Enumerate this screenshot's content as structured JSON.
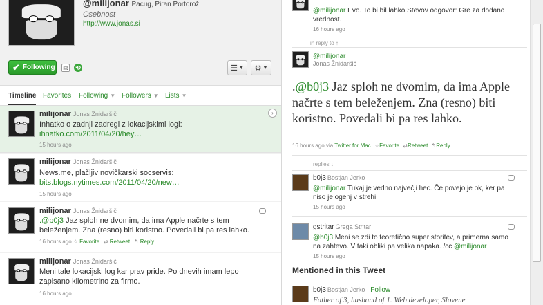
{
  "profile": {
    "username": "@milijonar",
    "location": "Pacug, Piran Portorož",
    "bio": "Osebnost",
    "url": "http://www.jonas.si",
    "following_label": "Following"
  },
  "tabs": [
    {
      "label": "Timeline"
    },
    {
      "label": "Favorites"
    },
    {
      "label": "Following"
    },
    {
      "label": "Followers"
    },
    {
      "label": "Lists"
    }
  ],
  "timeline": [
    {
      "user": "milijonar",
      "fullname": "Jonas Žnidaršič",
      "text_plain": "Inhatko o zadnji zadregi z lokacijskimi logi: ",
      "text_link": "ihnatko.com/2011/04/20/hey…",
      "time": "15 hours ago"
    },
    {
      "user": "milijonar",
      "fullname": "Jonas Žnidaršič",
      "text_plain": "News.me, plačljiv novičkarski socservis: ",
      "text_link": "bits.blogs.nytimes.com/2011/04/20/new…",
      "time": "15 hours ago"
    },
    {
      "user": "milijonar",
      "fullname": "Jonas Žnidaršič",
      "text_mention": ".@b0j3",
      "text_plain": " Jaz sploh ne dvomim, da ima Apple načrte s tem beleženjem. Zna (resno) biti koristno. Povedali bi pa res lahko.",
      "time": "16 hours ago",
      "favorite_label": "Favorite",
      "retweet_label": "Retweet",
      "reply_label": "Reply"
    },
    {
      "user": "milijonar",
      "fullname": "Jonas Žnidaršič",
      "text_plain": "Meni tale lokacijski log kar prav pride. Po dnevih imam lepo zapisano kilometrino za firmo.",
      "time": "16 hours ago"
    }
  ],
  "detail": {
    "top_tweet": {
      "mention": "@milijonar",
      "text": " Evo. To bi bil lahko Stevov odgovor: Gre za dodano vrednost.",
      "time": "16 hours ago"
    },
    "in_reply_to_label": "in reply to ↑",
    "main": {
      "user": "@milijonar",
      "fullname": "Jonas Žnidaršič",
      "text_prefix": ".",
      "mention": "@b0j3",
      "text": " Jaz sploh ne dvomim, da ima Apple načrte s tem beleženjem. Zna (resno) biti koristno. Povedali bi pa res lahko.",
      "time": "16 hours ago",
      "via_label": "via",
      "source": "Twitter for Mac",
      "favorite_label": "Favorite",
      "retweet_label": "Retweet",
      "reply_label": "Reply"
    },
    "replies_label": "replies ↓",
    "replies": [
      {
        "user": "b0j3",
        "fullname": "Bostjan Jerko",
        "mention": "@milijonar",
        "text": " Tukaj je vedno največji hec. Če povejo je ok, ker pa niso je ogenj v strehi.",
        "time": "15 hours ago"
      },
      {
        "user": "gstritar",
        "fullname": "Grega Stritar",
        "mention": "@b0j3",
        "text": " Meni se zdi to teoretično super storitev, a primerna samo na zahtevo. V taki obliki pa velika napaka. /cc ",
        "mention2": "@milijonar",
        "time": "15 hours ago"
      }
    ],
    "mentioned_heading": "Mentioned in this Tweet",
    "mentioned": {
      "user": "b0j3",
      "fullname": "Bostjan Jerko",
      "follow_label": "Follow",
      "bio": "Father of 3, husband of 1. Web developer, Slovene"
    }
  }
}
